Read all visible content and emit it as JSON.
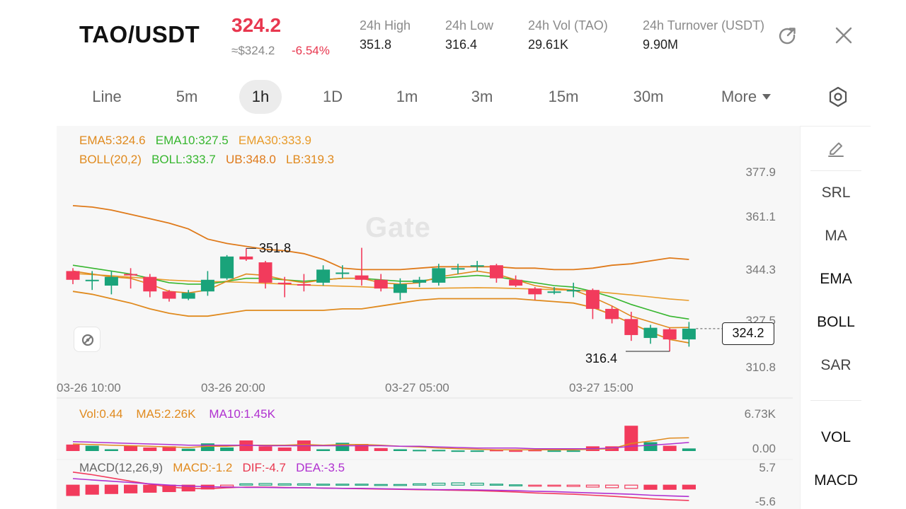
{
  "header": {
    "symbol": "TAO/USDT",
    "price": "324.2",
    "approx": "≈$324.2",
    "change": "-6.54%",
    "stats": [
      {
        "label": "24h  High",
        "value": "351.8"
      },
      {
        "label": "24h  Low",
        "value": "316.4"
      },
      {
        "label": "24h  Vol (TAO)",
        "value": "29.61K"
      },
      {
        "label": "24h  Turnover (USDT)",
        "value": "9.90M"
      }
    ],
    "share_icon": "share-icon",
    "close_icon": "close-icon"
  },
  "tabs": [
    {
      "label": "Line"
    },
    {
      "label": "5m"
    },
    {
      "label": "1h",
      "active": true
    },
    {
      "label": "1D"
    },
    {
      "label": "1m"
    },
    {
      "label": "3m"
    },
    {
      "label": "15m"
    },
    {
      "label": "30m"
    },
    {
      "label": "More"
    }
  ],
  "settings_icon": "hexagon-settings-icon",
  "legend": {
    "ema5": "EMA5:324.6",
    "ema10": "EMA10:327.5",
    "ema30": "EMA30:333.9",
    "boll_params": "BOLL(20,2)",
    "boll": "BOLL:333.7",
    "ub": "UB:348.0",
    "lb": "LB:319.3"
  },
  "y_axis": [
    "377.9",
    "361.1",
    "344.3",
    "327.5",
    "310.8"
  ],
  "x_axis": [
    "03-26 10:00",
    "03-26 20:00",
    "03-27 05:00",
    "03-27 15:00"
  ],
  "current_price_tag": "324.2",
  "high_annotation": "351.8",
  "low_annotation": "316.4",
  "watermark": "Gate",
  "volume": {
    "vol": "Vol:0.44",
    "ma5": "MA5:2.26K",
    "ma10": "MA10:1.45K",
    "y_axis": [
      "6.73K",
      "0.00"
    ]
  },
  "macd": {
    "params": "MACD(12,26,9)",
    "macd": "MACD:-1.2",
    "dif": "DIF:-4.7",
    "dea": "DEA:-3.5",
    "y_axis": [
      "5.7",
      "-5.6"
    ]
  },
  "side_panel": {
    "draw_icon": "pencil-icon",
    "items": [
      "SRL",
      "MA",
      "EMA",
      "BOLL",
      "SAR"
    ],
    "bottom_items": [
      "VOL",
      "MACD"
    ]
  },
  "colors": {
    "up": "#1aa37a",
    "down": "#f23b5c",
    "ema5": "#e08a1e",
    "ema10": "#37b62f",
    "ema30": "#e89b2a",
    "boll": "#37b62f",
    "ub": "#df7a1a",
    "lb": "#e08a1e",
    "ma10": "#b030d0"
  },
  "chart_data": {
    "type": "candlestick",
    "interval": "1h",
    "candles": [
      {
        "o": 344.0,
        "h": 345.0,
        "l": 339.5,
        "c": 341.0
      },
      {
        "o": 341.0,
        "h": 344.0,
        "l": 337.5,
        "c": 341.0
      },
      {
        "o": 339.0,
        "h": 344.0,
        "l": 336.0,
        "c": 342.0
      },
      {
        "o": 343.0,
        "h": 345.0,
        "l": 338.0,
        "c": 342.5
      },
      {
        "o": 342.0,
        "h": 343.0,
        "l": 335.0,
        "c": 337.0
      },
      {
        "o": 337.0,
        "h": 337.5,
        "l": 333.5,
        "c": 334.5
      },
      {
        "o": 334.5,
        "h": 337.5,
        "l": 334.0,
        "c": 336.5
      },
      {
        "o": 337.0,
        "h": 344.0,
        "l": 335.5,
        "c": 341.0
      },
      {
        "o": 341.5,
        "h": 349.5,
        "l": 341.0,
        "c": 349.0
      },
      {
        "o": 349.0,
        "h": 351.8,
        "l": 347.5,
        "c": 348.0
      },
      {
        "o": 347.0,
        "h": 347.5,
        "l": 338.0,
        "c": 340.0
      },
      {
        "o": 340.0,
        "h": 342.0,
        "l": 335.0,
        "c": 339.5
      },
      {
        "o": 339.5,
        "h": 343.0,
        "l": 337.0,
        "c": 339.0
      },
      {
        "o": 340.0,
        "h": 346.0,
        "l": 339.0,
        "c": 344.5
      },
      {
        "o": 343.0,
        "h": 346.0,
        "l": 341.5,
        "c": 343.5
      },
      {
        "o": 342.5,
        "h": 352.0,
        "l": 339.0,
        "c": 341.0
      },
      {
        "o": 341.0,
        "h": 343.0,
        "l": 337.0,
        "c": 338.0
      },
      {
        "o": 336.5,
        "h": 341.5,
        "l": 334.0,
        "c": 339.5
      },
      {
        "o": 340.0,
        "h": 342.0,
        "l": 338.5,
        "c": 341.0
      },
      {
        "o": 340.0,
        "h": 346.5,
        "l": 339.0,
        "c": 345.0
      },
      {
        "o": 345.0,
        "h": 346.5,
        "l": 343.0,
        "c": 345.0
      },
      {
        "o": 346.0,
        "h": 347.5,
        "l": 344.0,
        "c": 346.0
      },
      {
        "o": 346.0,
        "h": 346.5,
        "l": 340.0,
        "c": 341.5
      },
      {
        "o": 341.0,
        "h": 342.5,
        "l": 338.5,
        "c": 339.0
      },
      {
        "o": 338.0,
        "h": 338.5,
        "l": 334.0,
        "c": 336.0
      },
      {
        "o": 336.5,
        "h": 338.5,
        "l": 336.0,
        "c": 337.0
      },
      {
        "o": 337.0,
        "h": 340.0,
        "l": 335.0,
        "c": 337.5
      },
      {
        "o": 337.5,
        "h": 338.0,
        "l": 327.5,
        "c": 331.0
      },
      {
        "o": 331.0,
        "h": 332.0,
        "l": 326.0,
        "c": 327.5
      },
      {
        "o": 327.5,
        "h": 330.0,
        "l": 320.0,
        "c": 322.0
      },
      {
        "o": 321.0,
        "h": 325.5,
        "l": 319.0,
        "c": 324.5
      },
      {
        "o": 324.0,
        "h": 324.5,
        "l": 316.4,
        "c": 320.5
      },
      {
        "o": 320.5,
        "h": 326.5,
        "l": 318.0,
        "c": 324.2
      }
    ],
    "ema30": [
      343.2,
      342.8,
      342.4,
      341.9,
      341.4,
      340.9,
      340.6,
      340.4,
      340.3,
      340.1,
      339.8,
      339.5,
      339.2,
      339.0,
      338.8,
      338.6,
      338.3,
      338.1,
      338.0,
      338.1,
      338.2,
      338.3,
      338.2,
      338.0,
      337.8,
      337.6,
      337.4,
      337.0,
      336.4,
      335.8,
      335.1,
      334.4,
      333.9
    ],
    "ema10": [
      346.0,
      345.0,
      344.0,
      343.0,
      341.5,
      340.0,
      339.5,
      339.5,
      340.5,
      341.5,
      341.5,
      341.0,
      340.5,
      341.0,
      341.5,
      341.5,
      341.0,
      340.5,
      340.5,
      341.5,
      342.0,
      342.5,
      342.0,
      341.0,
      340.0,
      339.0,
      338.5,
      337.0,
      335.0,
      332.5,
      330.5,
      328.5,
      327.5
    ],
    "ema5": [
      344.0,
      343.0,
      342.0,
      341.5,
      339.5,
      337.0,
      336.5,
      337.5,
      340.5,
      343.0,
      342.5,
      341.0,
      340.0,
      341.0,
      341.5,
      341.5,
      340.0,
      339.5,
      340.0,
      342.0,
      343.0,
      344.0,
      343.0,
      341.0,
      339.0,
      338.0,
      337.5,
      335.0,
      332.0,
      328.5,
      326.5,
      324.5,
      324.6
    ],
    "ub": [
      366.5,
      366.0,
      365.0,
      363.5,
      362.0,
      360.5,
      358.5,
      355.0,
      353.5,
      352.5,
      351.5,
      351.0,
      350.0,
      348.0,
      345.0,
      344.5,
      344.5,
      344.5,
      345.0,
      345.5,
      345.5,
      345.5,
      345.5,
      345.0,
      345.0,
      344.5,
      344.5,
      345.0,
      346.0,
      346.5,
      347.5,
      348.5,
      348.0
    ],
    "lb": [
      337.0,
      336.0,
      334.5,
      333.0,
      331.0,
      329.5,
      328.5,
      328.5,
      329.5,
      330.5,
      330.5,
      330.5,
      330.5,
      330.5,
      331.0,
      331.0,
      332.0,
      333.0,
      334.0,
      334.5,
      334.5,
      334.5,
      334.5,
      334.5,
      334.0,
      333.5,
      333.0,
      331.5,
      329.0,
      326.0,
      323.0,
      320.5,
      319.3
    ],
    "volume": [
      1.1,
      0.9,
      0.3,
      0.9,
      0.6,
      0.8,
      0.4,
      1.3,
      0.6,
      1.8,
      0.8,
      0.6,
      1.8,
      0.3,
      1.4,
      1.2,
      0.5,
      0.3,
      0.2,
      0.2,
      0.1,
      0.1,
      0.2,
      0.1,
      0.2,
      0.1,
      0.1,
      0.8,
      0.8,
      4.3,
      1.5,
      0.9,
      0.44
    ],
    "vol_ma5": [
      1.2,
      1.1,
      1.0,
      0.9,
      0.8,
      0.7,
      0.6,
      0.8,
      0.8,
      1.0,
      1.0,
      1.0,
      1.1,
      1.0,
      1.1,
      1.1,
      1.0,
      0.8,
      0.7,
      0.5,
      0.4,
      0.3,
      0.2,
      0.2,
      0.2,
      0.2,
      0.2,
      0.3,
      0.4,
      1.3,
      1.7,
      2.2,
      2.26
    ],
    "vol_ma10": [
      1.6,
      1.5,
      1.4,
      1.3,
      1.2,
      1.1,
      1.0,
      1.0,
      1.0,
      1.0,
      0.9,
      0.9,
      0.9,
      0.9,
      0.9,
      0.9,
      0.9,
      0.8,
      0.8,
      0.7,
      0.6,
      0.5,
      0.5,
      0.5,
      0.4,
      0.4,
      0.4,
      0.4,
      0.5,
      0.8,
      1.0,
      1.2,
      1.45
    ],
    "macd_hist": [
      -3.2,
      -2.8,
      -2.6,
      -2.4,
      -2.2,
      -2.0,
      -1.8,
      -1.2,
      -0.5,
      0.4,
      0.5,
      0.4,
      0.4,
      0.3,
      0.3,
      0.3,
      0.2,
      0.2,
      0.4,
      0.6,
      0.7,
      0.6,
      0.3,
      0.1,
      -0.2,
      -0.3,
      -0.4,
      -0.6,
      -0.8,
      -1.0,
      -1.3,
      -1.3,
      -1.2
    ],
    "dif": [
      4.0,
      3.2,
      2.2,
      1.2,
      0.3,
      -0.6,
      -1.0,
      -1.1,
      -0.8,
      -0.6,
      -0.6,
      -0.7,
      -0.8,
      -0.9,
      -1.0,
      -1.1,
      -1.2,
      -1.3,
      -1.4,
      -1.5,
      -1.6,
      -1.7,
      -1.9,
      -2.1,
      -2.4,
      -2.6,
      -2.8,
      -3.1,
      -3.4,
      -3.8,
      -4.2,
      -4.5,
      -4.7
    ],
    "dea": [
      2.0,
      1.6,
      1.2,
      0.8,
      0.4,
      0.0,
      -0.3,
      -0.5,
      -0.6,
      -0.7,
      -0.7,
      -0.8,
      -0.8,
      -0.9,
      -1.0,
      -1.0,
      -1.1,
      -1.2,
      -1.3,
      -1.4,
      -1.4,
      -1.5,
      -1.6,
      -1.7,
      -1.9,
      -2.0,
      -2.2,
      -2.4,
      -2.6,
      -2.8,
      -3.1,
      -3.3,
      -3.5
    ],
    "price_range": [
      310.8,
      377.9
    ],
    "volume_range": [
      0.0,
      6.73
    ],
    "macd_range": [
      -5.6,
      5.7
    ]
  }
}
